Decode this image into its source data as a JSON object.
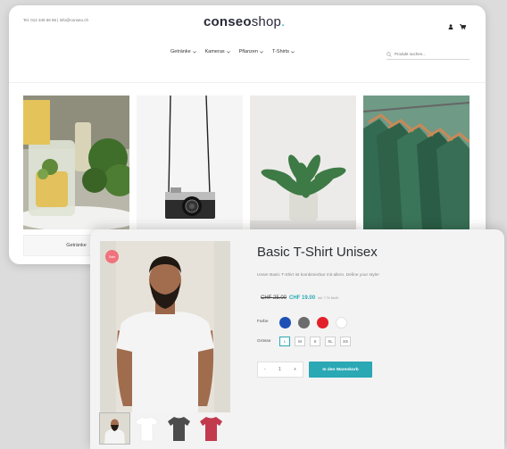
{
  "header": {
    "contact": "Tel. 012 345 56 56 | info@conseo.ch",
    "logo_bold": "conseo",
    "logo_light": "shop",
    "logo_dot": "."
  },
  "nav": {
    "items": [
      {
        "label": "Getränke"
      },
      {
        "label": "Kameras"
      },
      {
        "label": "Pflanzen"
      },
      {
        "label": "T-Shirts"
      }
    ]
  },
  "search": {
    "placeholder": "Produkt suchen..."
  },
  "categories": {
    "first_caption": "Getränke"
  },
  "product": {
    "sale_badge": "Sale",
    "title": "Basic T-Shirt Unisex",
    "description": "Unser Basic T-Shirt ist kombinierbar mit allem. Define your style!",
    "old_price": "CHF 25.00",
    "new_price": "CHF 19.00",
    "vat_note": "inkl. 7.7% MwSt.",
    "color_label": "Farbe",
    "colors": [
      "#1e4fb5",
      "#6c6c6c",
      "#e3202a",
      "#ffffff"
    ],
    "size_label": "Grösse",
    "sizes": [
      "L",
      "M",
      "S",
      "XL",
      "XS"
    ],
    "selected_size": "L",
    "quantity": "1",
    "qty_minus": "-",
    "qty_plus": "+",
    "cart_button": "In den Warenkorb"
  },
  "icons": {
    "account": "user-icon",
    "cart": "cart-icon",
    "search": "search-icon",
    "dropdown": "chevron-down-icon"
  },
  "accent_color": "#2aa8b4"
}
